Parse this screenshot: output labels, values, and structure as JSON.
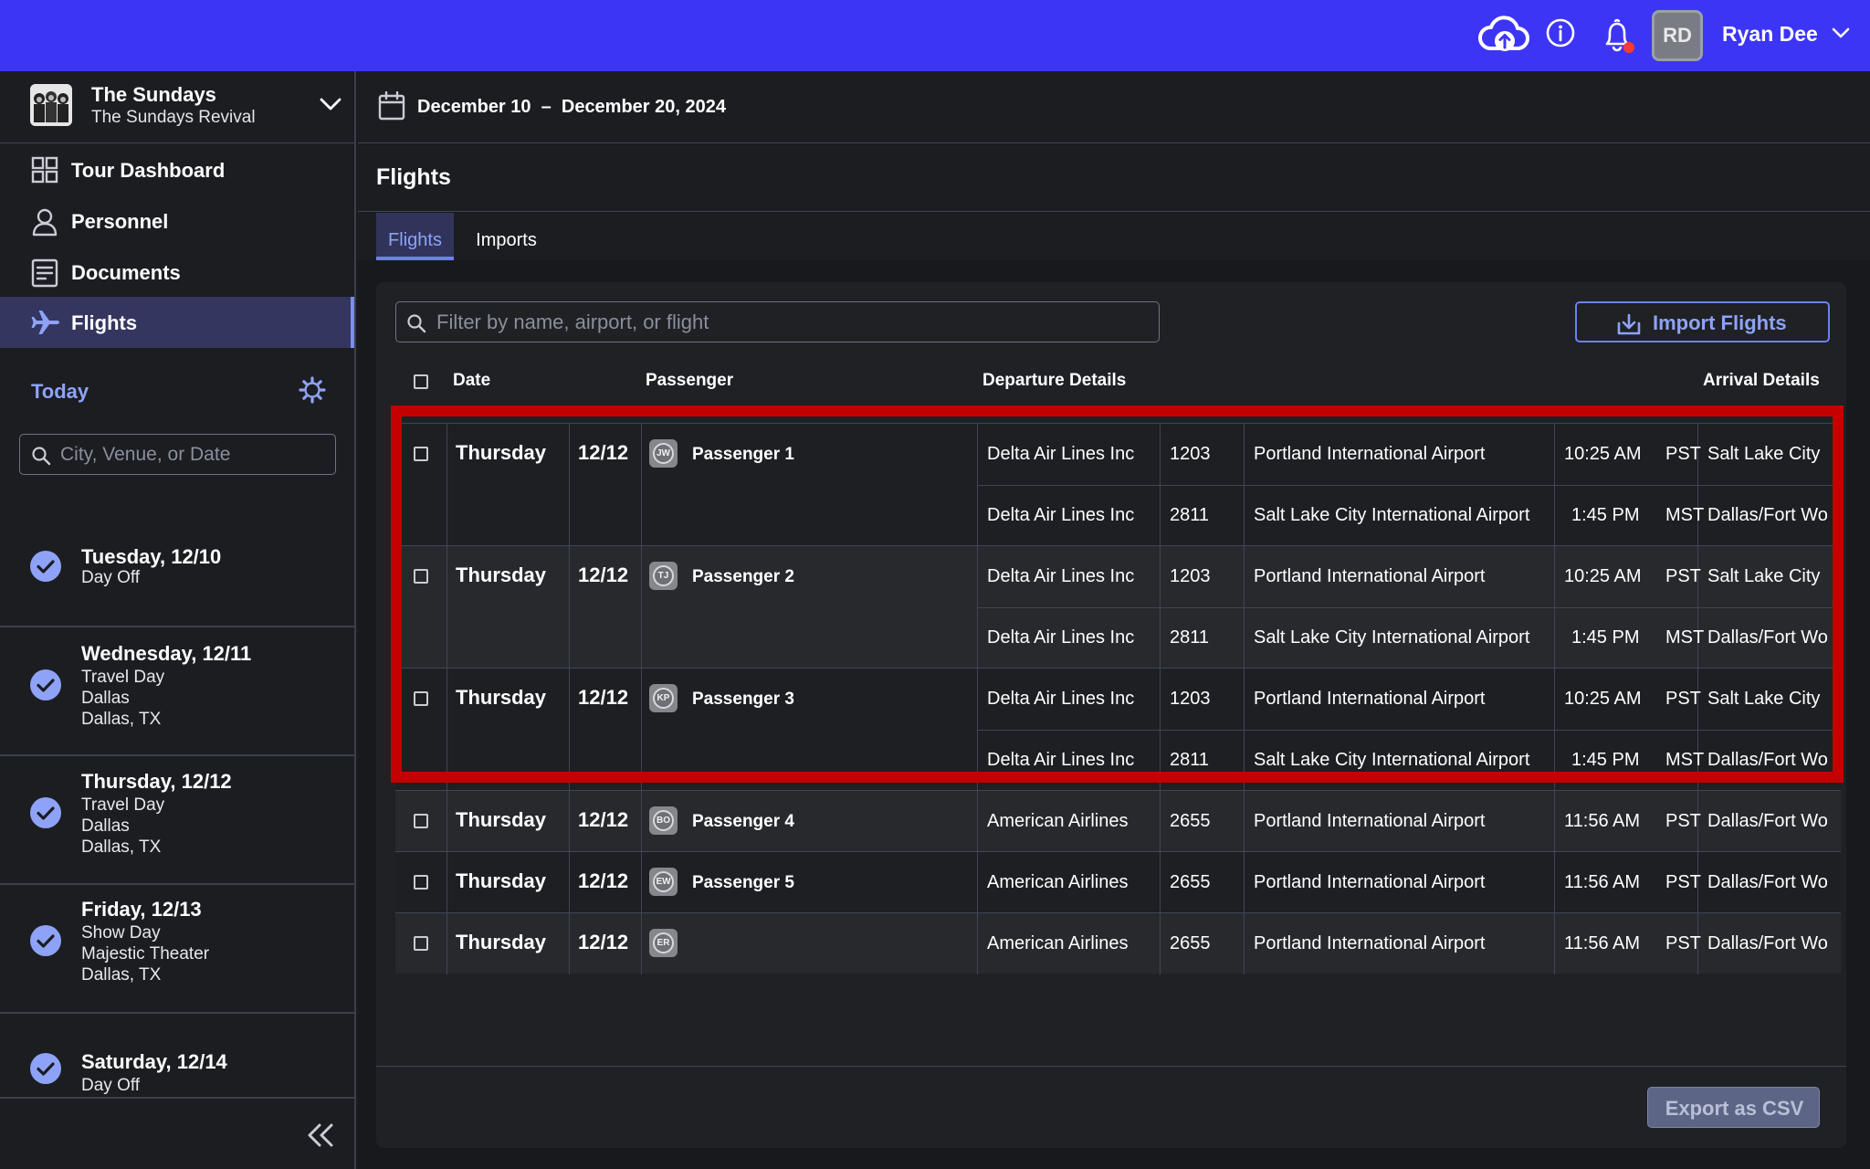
{
  "topbar": {
    "user_initials": "RD",
    "user_name": "Ryan Dee",
    "icons": [
      "cloud-upload-icon",
      "info-icon",
      "bell-icon",
      "chevron-down-icon"
    ],
    "accent_color": "#3d35f6"
  },
  "sidebar": {
    "band_name": "The Sundays",
    "band_subtitle": "The Sundays Revival",
    "nav": [
      {
        "label": "Tour Dashboard",
        "icon": "grid-icon"
      },
      {
        "label": "Personnel",
        "icon": "person-icon"
      },
      {
        "label": "Documents",
        "icon": "document-icon"
      },
      {
        "label": "Flights",
        "icon": "plane-icon",
        "active": true
      }
    ],
    "today_label": "Today",
    "search_placeholder": "City, Venue, or Date",
    "days": [
      {
        "title": "Tuesday, 12/10",
        "lines": [
          "Day Off"
        ]
      },
      {
        "title": "Wednesday, 12/11",
        "lines": [
          "Travel Day",
          "Dallas",
          "Dallas, TX"
        ]
      },
      {
        "title": "Thursday, 12/12",
        "lines": [
          "Travel Day",
          "Dallas",
          "Dallas, TX"
        ]
      },
      {
        "title": "Friday, 12/13",
        "lines": [
          "Show Day",
          "Majestic Theater",
          "Dallas, TX"
        ]
      },
      {
        "title": "Saturday, 12/14",
        "lines": [
          "Day Off"
        ]
      }
    ]
  },
  "header": {
    "date_range": "December 10  –  December 20, 2024",
    "page_title": "Flights",
    "tabs": [
      "Flights",
      "Imports"
    ]
  },
  "toolbar": {
    "filter_placeholder": "Filter by name, airport, or flight",
    "import_label": "Import Flights",
    "export_label": "Export as CSV"
  },
  "table": {
    "columns": [
      "Date",
      "Passenger",
      "Departure Details",
      "Arrival Details"
    ],
    "groups": [
      {
        "day": "Thursday",
        "date": "12/12",
        "initials": "JW",
        "passenger": "Passenger 1",
        "segments": [
          {
            "airline": "Delta Air Lines Inc",
            "flight": "1203",
            "airport": "Portland International Airport",
            "time": "10:25 AM",
            "tz": "PST",
            "arrival": "Salt Lake City"
          },
          {
            "airline": "Delta Air Lines Inc",
            "flight": "2811",
            "airport": "Salt Lake City International Airport",
            "time": "1:45 PM",
            "tz": "MST",
            "arrival": "Dallas/Fort Wo"
          }
        ]
      },
      {
        "day": "Thursday",
        "date": "12/12",
        "initials": "TJ",
        "passenger": "Passenger 2",
        "segments": [
          {
            "airline": "Delta Air Lines Inc",
            "flight": "1203",
            "airport": "Portland International Airport",
            "time": "10:25 AM",
            "tz": "PST",
            "arrival": "Salt Lake City"
          },
          {
            "airline": "Delta Air Lines Inc",
            "flight": "2811",
            "airport": "Salt Lake City International Airport",
            "time": "1:45 PM",
            "tz": "MST",
            "arrival": "Dallas/Fort Wo"
          }
        ]
      },
      {
        "day": "Thursday",
        "date": "12/12",
        "initials": "KP",
        "passenger": "Passenger 3",
        "segments": [
          {
            "airline": "Delta Air Lines Inc",
            "flight": "1203",
            "airport": "Portland International Airport",
            "time": "10:25 AM",
            "tz": "PST",
            "arrival": "Salt Lake City"
          },
          {
            "airline": "Delta Air Lines Inc",
            "flight": "2811",
            "airport": "Salt Lake City International Airport",
            "time": "1:45 PM",
            "tz": "MST",
            "arrival": "Dallas/Fort Wo"
          }
        ]
      },
      {
        "day": "Thursday",
        "date": "12/12",
        "initials": "BO",
        "passenger": "Passenger 4",
        "segments": [
          {
            "airline": "American Airlines",
            "flight": "2655",
            "airport": "Portland International Airport",
            "time": "11:56 AM",
            "tz": "PST",
            "arrival": "Dallas/Fort Wo"
          }
        ]
      },
      {
        "day": "Thursday",
        "date": "12/12",
        "initials": "EW",
        "passenger": "Passenger 5",
        "segments": [
          {
            "airline": "American Airlines",
            "flight": "2655",
            "airport": "Portland International Airport",
            "time": "11:56 AM",
            "tz": "PST",
            "arrival": "Dallas/Fort Wo"
          }
        ]
      },
      {
        "day": "Thursday",
        "date": "12/12",
        "initials": "ER",
        "passenger": "",
        "segments": [
          {
            "airline": "American Airlines",
            "flight": "2655",
            "airport": "Portland International Airport",
            "time": "11:56 AM",
            "tz": "PST",
            "arrival": "Dallas/Fort Wo"
          }
        ]
      }
    ]
  },
  "colors": {
    "highlight": "#c40000",
    "active_tab": "#8ea3f7"
  }
}
